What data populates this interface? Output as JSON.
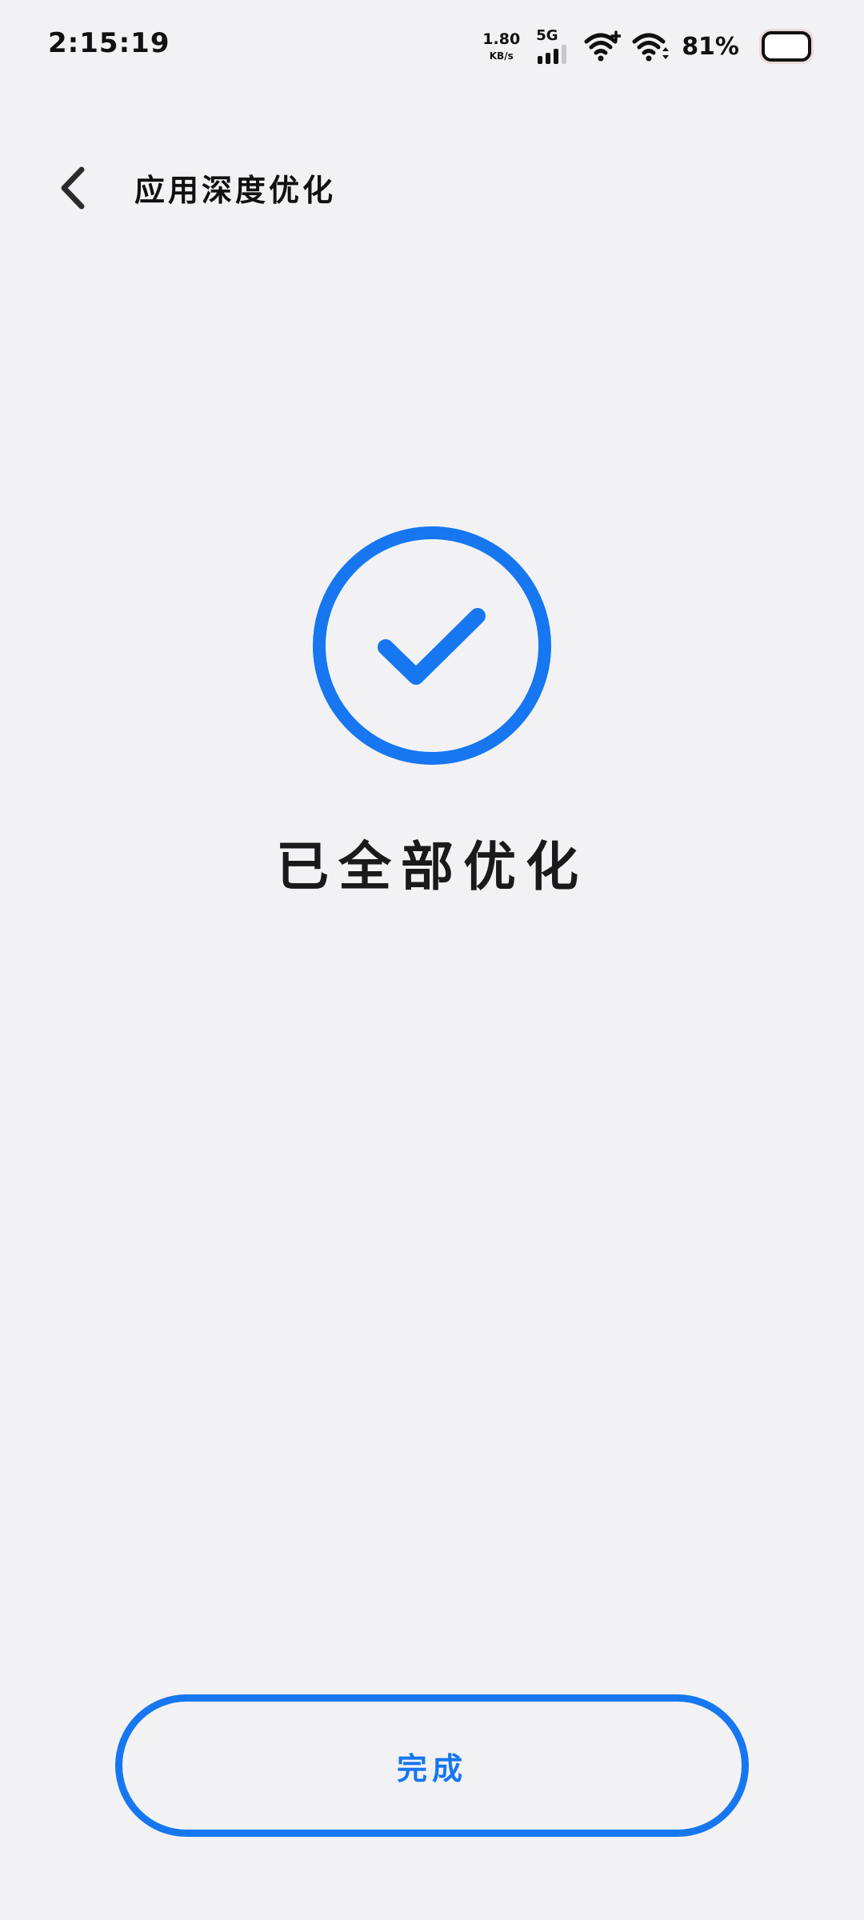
{
  "status_bar": {
    "time": "2:15:19",
    "net_speed_value": "1.80",
    "net_speed_unit": "KB/s",
    "network_type": "5G",
    "battery_percent": "81%"
  },
  "header": {
    "title": "应用深度优化",
    "back_icon": "chevron-left-icon"
  },
  "result": {
    "icon": "check-circle-icon",
    "message": "已全部优化"
  },
  "actions": {
    "done_label": "完成"
  },
  "colors": {
    "accent": "#1677f0",
    "background": "#f2f2f5",
    "text": "#1a1a1a"
  }
}
